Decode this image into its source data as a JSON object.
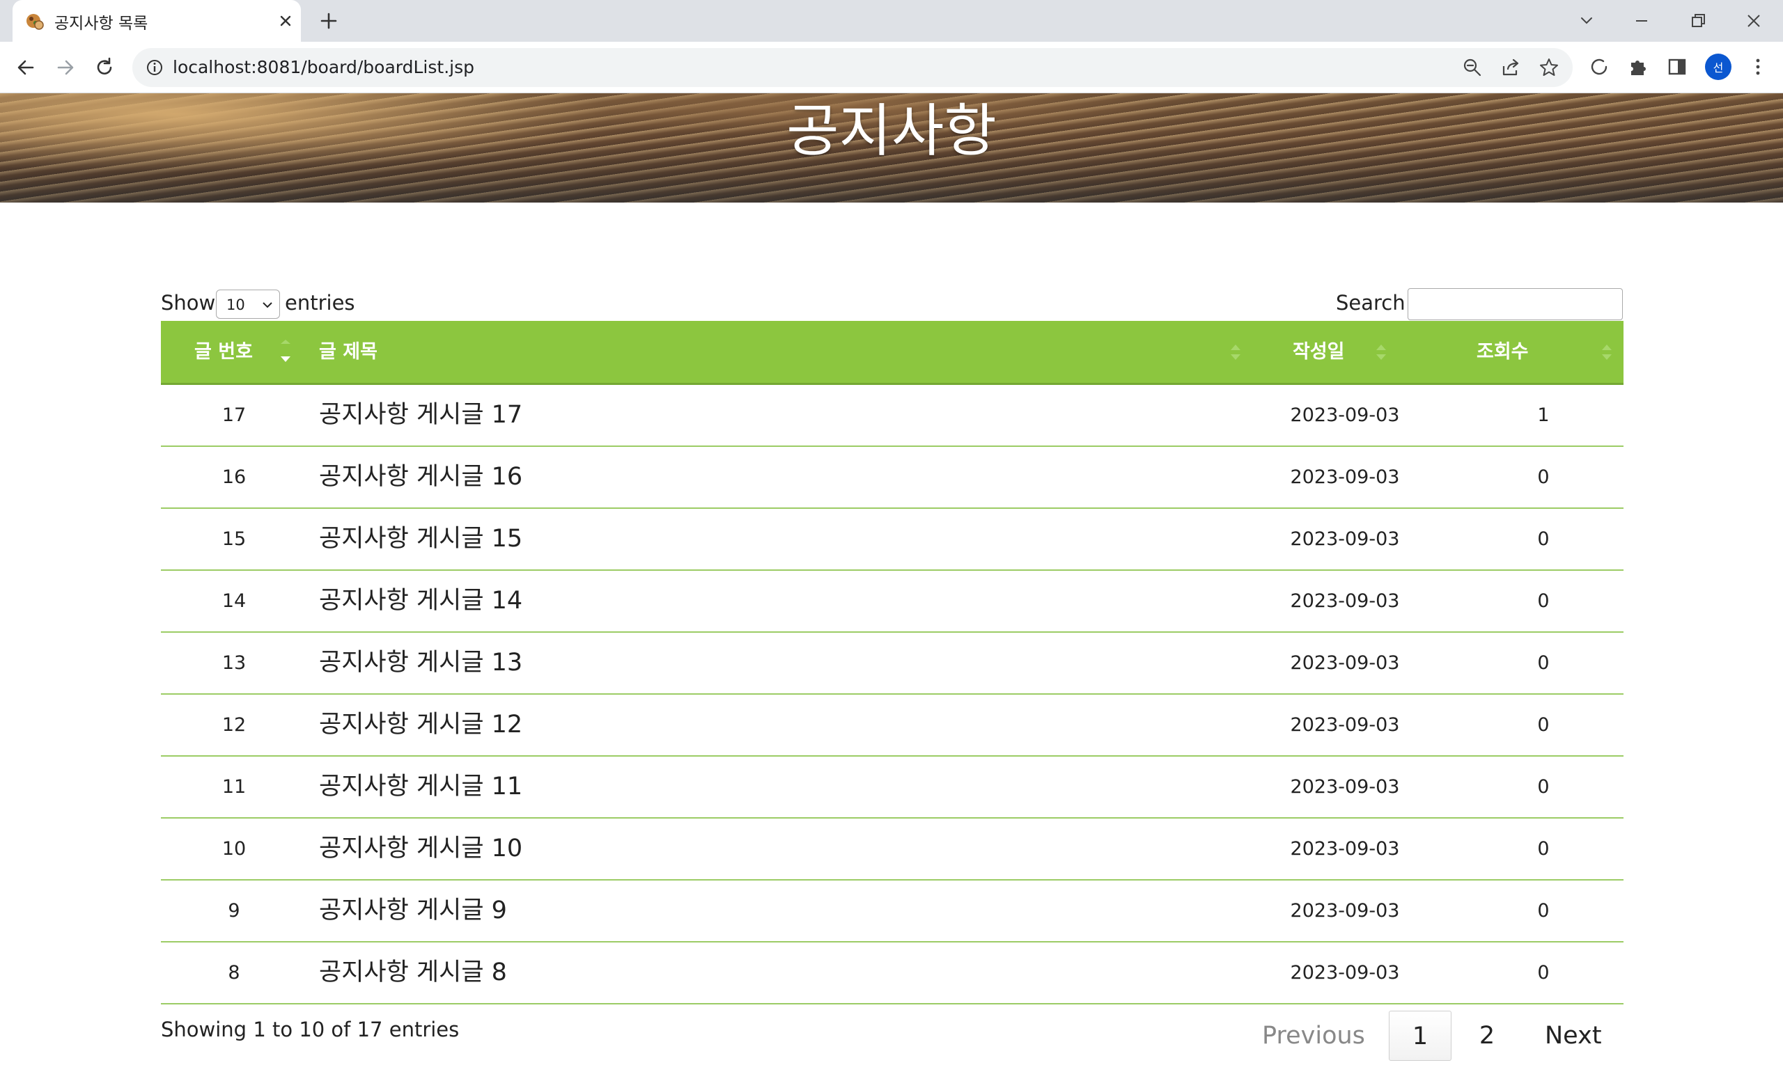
{
  "browser": {
    "tab_title": "공지사항 목록",
    "url": "localhost:8081/board/boardList.jsp",
    "profile_initial": "선"
  },
  "page": {
    "title": "공지사항"
  },
  "controls": {
    "show_label": "Show",
    "entries_label": "entries",
    "page_size": "10",
    "search_label": "Search:",
    "search_value": ""
  },
  "table": {
    "headers": {
      "no": "글 번호",
      "title": "글 제목",
      "date": "작성일",
      "views": "조회수"
    },
    "rows": [
      {
        "no": "17",
        "title": "공지사항 게시글 17",
        "date": "2023-09-03",
        "views": "1"
      },
      {
        "no": "16",
        "title": "공지사항 게시글 16",
        "date": "2023-09-03",
        "views": "0"
      },
      {
        "no": "15",
        "title": "공지사항 게시글 15",
        "date": "2023-09-03",
        "views": "0"
      },
      {
        "no": "14",
        "title": "공지사항 게시글 14",
        "date": "2023-09-03",
        "views": "0"
      },
      {
        "no": "13",
        "title": "공지사항 게시글 13",
        "date": "2023-09-03",
        "views": "0"
      },
      {
        "no": "12",
        "title": "공지사항 게시글 12",
        "date": "2023-09-03",
        "views": "0"
      },
      {
        "no": "11",
        "title": "공지사항 게시글 11",
        "date": "2023-09-03",
        "views": "0"
      },
      {
        "no": "10",
        "title": "공지사항 게시글 10",
        "date": "2023-09-03",
        "views": "0"
      },
      {
        "no": "9",
        "title": "공지사항 게시글 9",
        "date": "2023-09-03",
        "views": "0"
      },
      {
        "no": "8",
        "title": "공지사항 게시글 8",
        "date": "2023-09-03",
        "views": "0"
      }
    ]
  },
  "footer": {
    "info": "Showing 1 to 10 of 17 entries",
    "previous": "Previous",
    "current_page": "1",
    "page_2": "2",
    "next": "Next"
  },
  "colors": {
    "header_green": "#8cc63f",
    "row_border_green": "#9ccc65",
    "profile_blue": "#0b57d0"
  }
}
